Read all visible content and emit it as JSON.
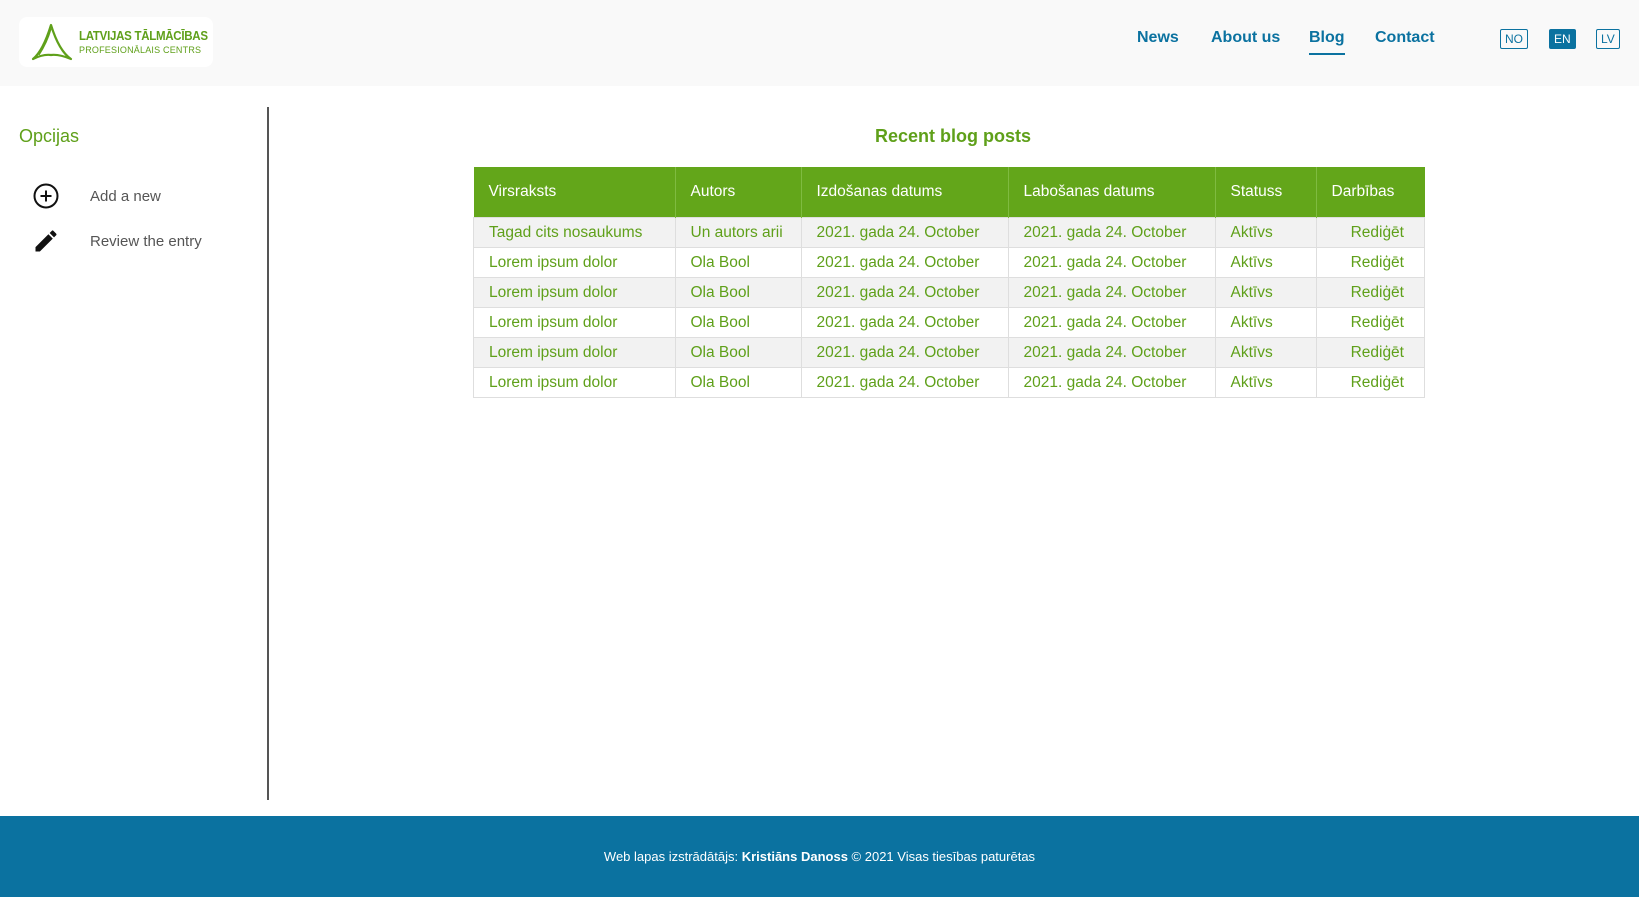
{
  "header": {
    "logo_line1": "LATVIJAS TĀLMĀCĪBAS",
    "logo_line2": "PROFESIONĀLAIS CENTRS",
    "nav": [
      {
        "label": "News"
      },
      {
        "label": "About us"
      },
      {
        "label": "Blog",
        "active": true
      },
      {
        "label": "Contact"
      }
    ],
    "languages": [
      {
        "label": "NO"
      },
      {
        "label": "EN",
        "active": true
      },
      {
        "label": "LV"
      }
    ]
  },
  "sidebar": {
    "title": "Opcijas",
    "items": [
      {
        "label": "Add a new",
        "icon": "plus-circle-icon"
      },
      {
        "label": "Review the entry",
        "icon": "pencil-icon"
      }
    ]
  },
  "main": {
    "title": "Recent blog posts",
    "columns": [
      "Virsraksts",
      "Autors",
      "Izdošanas datums",
      "Labošanas datums",
      "Statuss",
      "Darbības"
    ],
    "rows": [
      [
        "Tagad cits nosaukums",
        "Un autors arii",
        "2021. gada 24. October",
        "2021. gada 24. October",
        "Aktīvs",
        "Rediģēt"
      ],
      [
        "Lorem ipsum dolor",
        "Ola Bool",
        "2021. gada 24. October",
        "2021. gada 24. October",
        "Aktīvs",
        "Rediģēt"
      ],
      [
        "Lorem ipsum dolor",
        "Ola Bool",
        "2021. gada 24. October",
        "2021. gada 24. October",
        "Aktīvs",
        "Rediģēt"
      ],
      [
        "Lorem ipsum dolor",
        "Ola Bool",
        "2021. gada 24. October",
        "2021. gada 24. October",
        "Aktīvs",
        "Rediģēt"
      ],
      [
        "Lorem ipsum dolor",
        "Ola Bool",
        "2021. gada 24. October",
        "2021. gada 24. October",
        "Aktīvs",
        "Rediģēt"
      ],
      [
        "Lorem ipsum dolor",
        "Ola Bool",
        "2021. gada 24. October",
        "2021. gada 24. October",
        "Aktīvs",
        "Rediģēt"
      ]
    ]
  },
  "footer": {
    "prefix": "Web lapas izstrādātājs:",
    "author": "Kristiāns Danoss",
    "suffix": "© 2021 Visas tiesības paturētas"
  },
  "colors": {
    "brand_green": "#63a61a",
    "brand_blue": "#0b72a0"
  }
}
